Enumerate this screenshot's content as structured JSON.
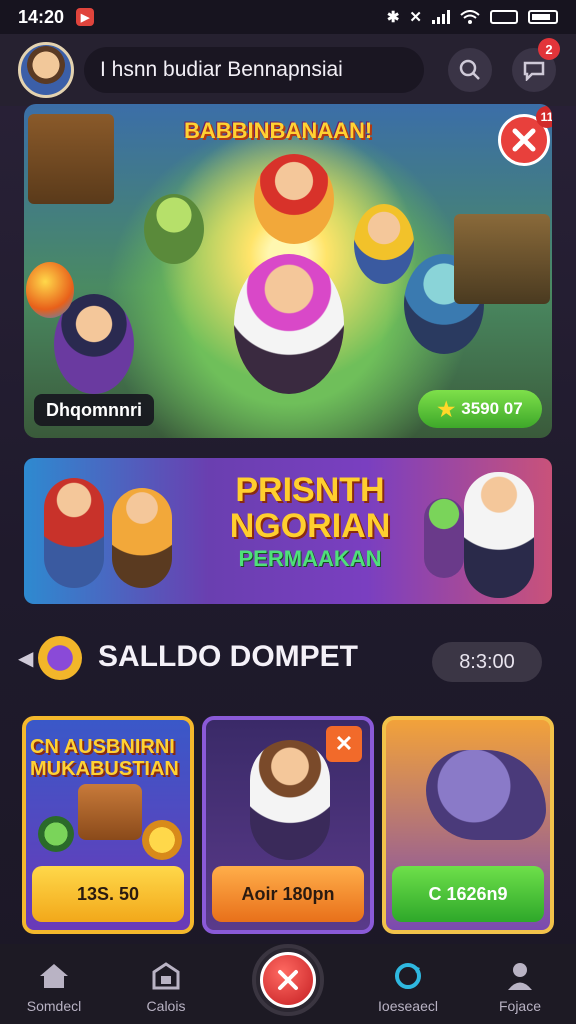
{
  "status_bar": {
    "time": "14:20"
  },
  "header": {
    "username": "I hsnn budiar Bennapnsiai",
    "chat_badge": "2"
  },
  "hero": {
    "title": "BABBINBANAAN!",
    "close_badge": "11",
    "label": "Dhqomnnri",
    "price": "3590 07"
  },
  "promo": {
    "line1": "PRISNTH",
    "line2": "NGORIAN",
    "line3": "PERMAAKAN"
  },
  "wallet": {
    "title": "SALLDO DOMPET",
    "balance": "8:3:00"
  },
  "cards": [
    {
      "title": "CN AUSBNIRNI MUKABUSTIAN",
      "button": "13S. 50"
    },
    {
      "title": "",
      "button": "Aoir 180pn"
    },
    {
      "title": "",
      "button": "C 1626n9"
    }
  ],
  "nav": [
    {
      "label": "Somdecl",
      "icon": "home-icon"
    },
    {
      "label": "Calois",
      "icon": "store-icon"
    },
    {
      "label": "Ioeseaecl",
      "icon": "refresh-icon"
    },
    {
      "label": "Fojace",
      "icon": "profile-icon"
    }
  ],
  "colors": {
    "accent_red": "#e8403c",
    "accent_green": "#3ea82a",
    "accent_gold": "#f2b62a",
    "accent_purple": "#7a3fc0"
  }
}
